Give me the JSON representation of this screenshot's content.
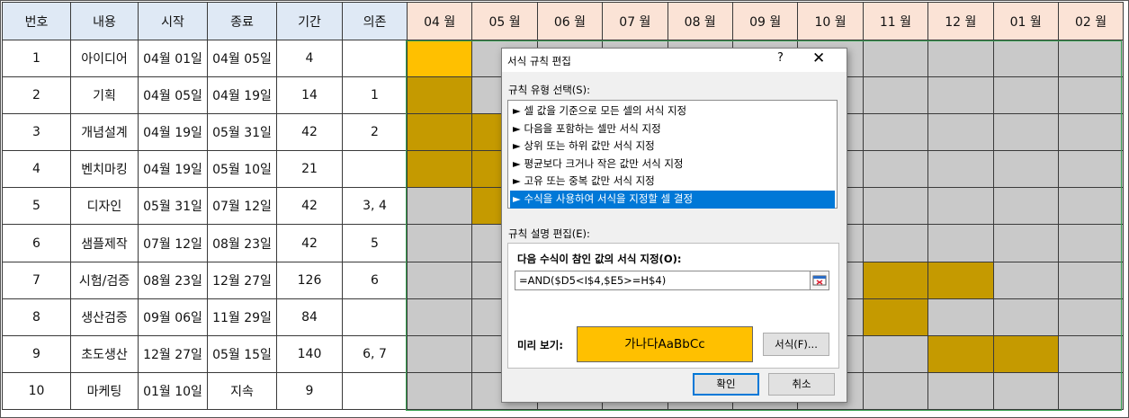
{
  "colors": {
    "highlight": "#c59a00",
    "highlight_first": "#ffc000",
    "preview": "#ffc000"
  },
  "table": {
    "headers": [
      "번호",
      "내용",
      "시작",
      "종료",
      "기간",
      "의존"
    ],
    "months": [
      "04 월",
      "05 월",
      "06 월",
      "07 월",
      "08 월",
      "09 월",
      "10 월",
      "11 월",
      "12 월",
      "01 월",
      "02 월"
    ],
    "rows": [
      {
        "no": "1",
        "task": "아이디어",
        "start": "04월 01일",
        "end": "04월 05일",
        "dur": "4",
        "dep": ""
      },
      {
        "no": "2",
        "task": "기획",
        "start": "04월 05일",
        "end": "04월 19일",
        "dur": "14",
        "dep": "1"
      },
      {
        "no": "3",
        "task": "개념설계",
        "start": "04월 19일",
        "end": "05월 31일",
        "dur": "42",
        "dep": "2"
      },
      {
        "no": "4",
        "task": "벤치마킹",
        "start": "04월 19일",
        "end": "05월 10일",
        "dur": "21",
        "dep": ""
      },
      {
        "no": "5",
        "task": "디자인",
        "start": "05월 31일",
        "end": "07월 12일",
        "dur": "42",
        "dep": "3, 4"
      },
      {
        "no": "6",
        "task": "샘플제작",
        "start": "07월 12일",
        "end": "08월 23일",
        "dur": "42",
        "dep": "5"
      },
      {
        "no": "7",
        "task": "시험/검증",
        "start": "08월 23일",
        "end": "12월 27일",
        "dur": "126",
        "dep": "6"
      },
      {
        "no": "8",
        "task": "생산검증",
        "start": "09월 06일",
        "end": "11월 29일",
        "dur": "84",
        "dep": ""
      },
      {
        "no": "9",
        "task": "초도생산",
        "start": "12월 27일",
        "end": "05월 15일",
        "dur": "140",
        "dep": "6, 7"
      },
      {
        "no": "10",
        "task": "마케팅",
        "start": "01월 10일",
        "end": "지속",
        "dur": "9",
        "dep": ""
      }
    ],
    "gantt": [
      [
        1,
        0,
        0,
        0,
        0,
        0,
        0,
        0,
        0,
        0,
        0
      ],
      [
        1,
        0,
        0,
        0,
        0,
        0,
        0,
        0,
        0,
        0,
        0
      ],
      [
        1,
        1,
        0,
        0,
        0,
        0,
        0,
        0,
        0,
        0,
        0
      ],
      [
        1,
        1,
        0,
        0,
        0,
        0,
        0,
        0,
        0,
        0,
        0
      ],
      [
        0,
        1,
        0,
        0,
        0,
        0,
        0,
        0,
        0,
        0,
        0
      ],
      [
        0,
        0,
        0,
        0,
        0,
        0,
        0,
        0,
        0,
        0,
        0
      ],
      [
        0,
        0,
        0,
        0,
        0,
        0,
        0,
        1,
        1,
        0,
        0
      ],
      [
        0,
        0,
        0,
        0,
        0,
        0,
        0,
        1,
        0,
        0,
        0
      ],
      [
        0,
        0,
        0,
        0,
        0,
        0,
        0,
        0,
        1,
        1,
        0
      ],
      [
        0,
        0,
        0,
        0,
        0,
        0,
        0,
        0,
        0,
        0,
        0
      ]
    ]
  },
  "dialog": {
    "title": "서식 규칙 편집",
    "help": "?",
    "close": "✕",
    "rule_type_label": "규칙 유형 선택(S):",
    "rule_types": [
      "► 셀 값을 기준으로 모든 셀의 서식 지정",
      "► 다음을 포함하는 셀만 서식 지정",
      "► 상위 또는 하위 값만 서식 지정",
      "► 평균보다 크거나 작은 값만 서식 지정",
      "► 고유 또는 중복 값만 서식 지정",
      "► 수식을 사용하여 서식을 지정할 셀 결정"
    ],
    "selected_rule": 5,
    "desc_label": "규칙 설명 편집(E):",
    "formula_label": "다음 수식이 참인 값의 서식 지정(O):",
    "formula": "=AND($D5<I$4,$E5>=H$4)",
    "preview_label": "미리 보기:",
    "preview_text": "가나다AaBbCc",
    "format_button": "서식(F)...",
    "ok_button": "확인",
    "cancel_button": "취소"
  }
}
